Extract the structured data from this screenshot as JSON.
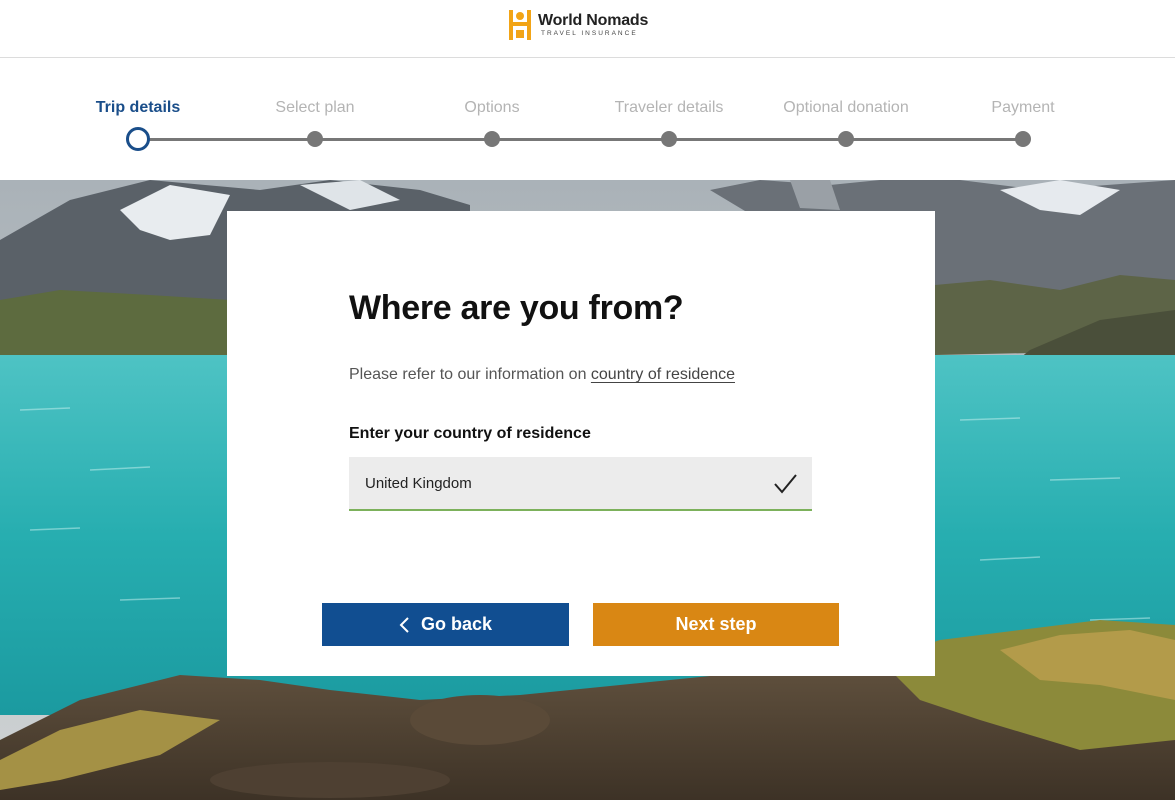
{
  "brand": {
    "name": "World Nomads",
    "tagline": "TRAVEL INSURANCE",
    "color": "#f2a416"
  },
  "stepper": {
    "steps": [
      {
        "label": "Trip details",
        "active": true
      },
      {
        "label": "Select plan",
        "active": false
      },
      {
        "label": "Options",
        "active": false
      },
      {
        "label": "Traveler details",
        "active": false
      },
      {
        "label": "Optional donation",
        "active": false
      },
      {
        "label": "Payment",
        "active": false
      }
    ],
    "active_color": "#1a4e8a"
  },
  "form": {
    "heading": "Where are you from?",
    "info_prefix": "Please refer to our information on ",
    "info_link": "country of residence",
    "field_label": "Enter your country of residence",
    "country_value": "United Kingdom",
    "valid_icon": "checkmark-icon"
  },
  "actions": {
    "back_label": "Go back",
    "next_label": "Next step",
    "back_color": "#114e91",
    "next_color": "#d98714"
  }
}
